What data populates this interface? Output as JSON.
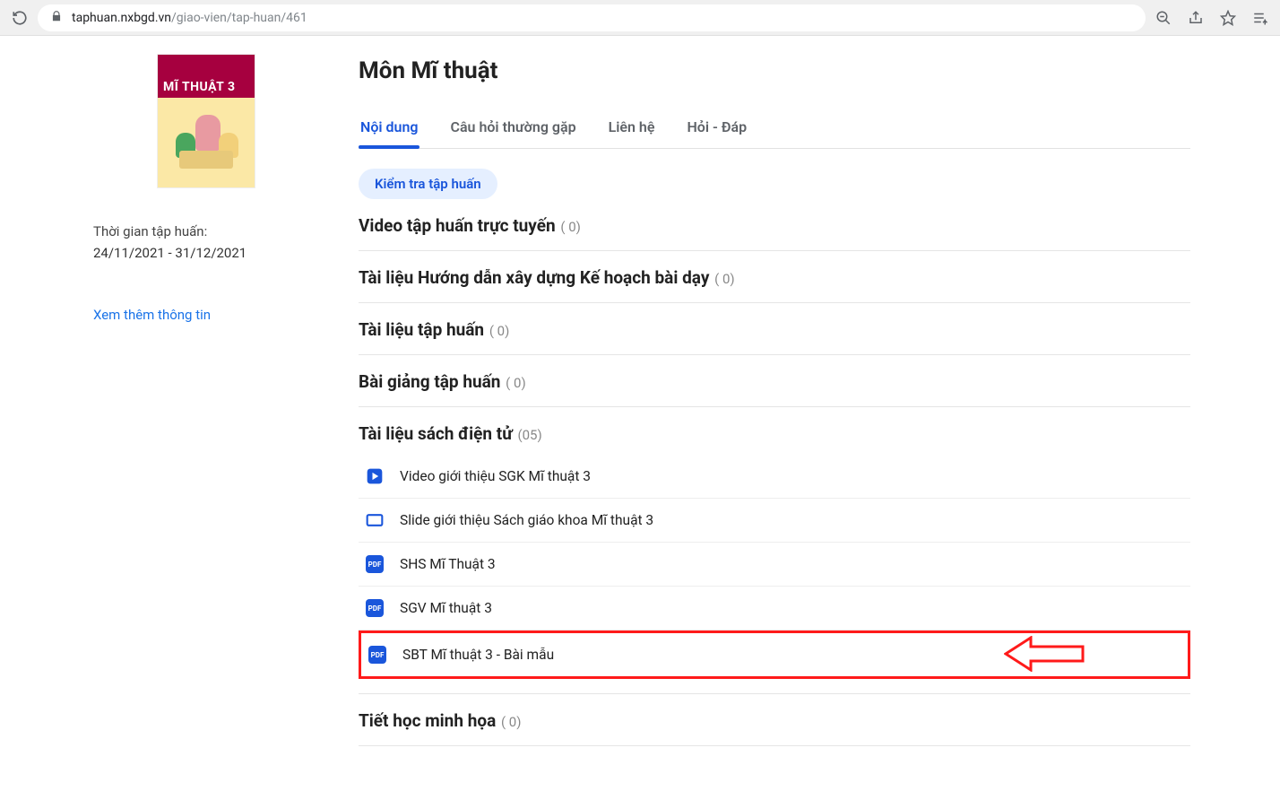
{
  "browser": {
    "url_host": "taphuan.nxbgd.vn",
    "url_path": "/giao-vien/tap-huan/461"
  },
  "sidebar": {
    "cover_title": "MĨ THUẬT 3",
    "time_label": "Thời gian tập huấn:",
    "time_range": "24/11/2021 - 31/12/2021",
    "more_link": "Xem thêm thông tin"
  },
  "main": {
    "title": "Môn Mĩ thuật",
    "tabs": [
      {
        "label": "Nội dung",
        "active": true
      },
      {
        "label": "Câu hỏi thường gặp",
        "active": false
      },
      {
        "label": "Liên hệ",
        "active": false
      },
      {
        "label": "Hỏi - Đáp",
        "active": false
      }
    ],
    "pill": "Kiểm tra tập huấn",
    "sections": [
      {
        "title": "Video tập huấn trực tuyến",
        "count": "( 0)"
      },
      {
        "title": "Tài liệu Hướng dẫn xây dựng Kế hoạch bài dạy",
        "count": "( 0)"
      },
      {
        "title": "Tài liệu tập huấn",
        "count": "( 0)"
      },
      {
        "title": "Bài giảng tập huấn",
        "count": "( 0)"
      },
      {
        "title": "Tài liệu sách điện tử",
        "count": "(05)",
        "items": [
          {
            "icon": "play",
            "label": "Video giới thiệu SGK Mĩ thuật 3"
          },
          {
            "icon": "slide",
            "label": "Slide giới thiệu Sách giáo khoa Mĩ thuật 3"
          },
          {
            "icon": "pdf",
            "label": "SHS Mĩ Thuật 3"
          },
          {
            "icon": "pdf",
            "label": "SGV Mĩ thuật 3"
          },
          {
            "icon": "pdf",
            "label": "SBT Mĩ thuật 3 - Bài mẫu",
            "highlight": true
          }
        ]
      },
      {
        "title": "Tiết học minh họa",
        "count": "( 0)"
      }
    ]
  }
}
